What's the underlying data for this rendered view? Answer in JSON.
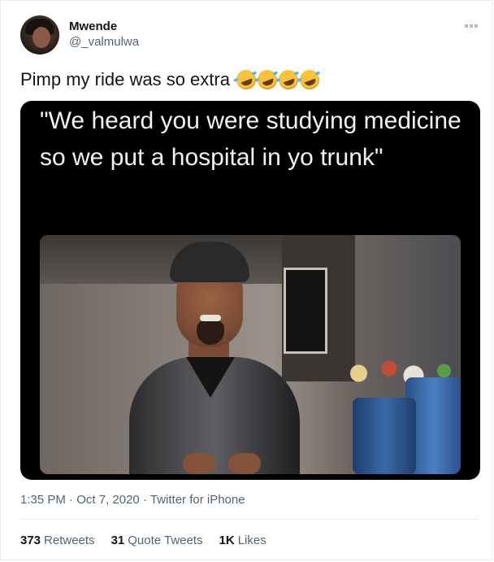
{
  "author": {
    "name": "Mwende",
    "handle": "@_valmulwa"
  },
  "tweet": {
    "text": "Pimp my ride was so extra",
    "emojis": [
      "rolling-on-floor-laughing",
      "rolling-on-floor-laughing",
      "rolling-on-floor-laughing",
      "rolling-on-floor-laughing"
    ],
    "media_caption": "\"We heard you were studying medicine so we put a hospital in yo trunk\""
  },
  "meta": {
    "time": "1:35 PM",
    "date": "Oct 7, 2020",
    "source": "Twitter for iPhone",
    "separator": "·"
  },
  "stats": {
    "retweets_count": "373",
    "retweets_label": "Retweets",
    "quotes_count": "31",
    "quotes_label": "Quote Tweets",
    "likes_count": "1K",
    "likes_label": "Likes"
  },
  "icons": {
    "more": "more-options-icon"
  },
  "colors": {
    "text_primary": "#0f1419",
    "text_secondary": "#536471",
    "border": "#e6ecf0",
    "media_bg": "#000000"
  }
}
